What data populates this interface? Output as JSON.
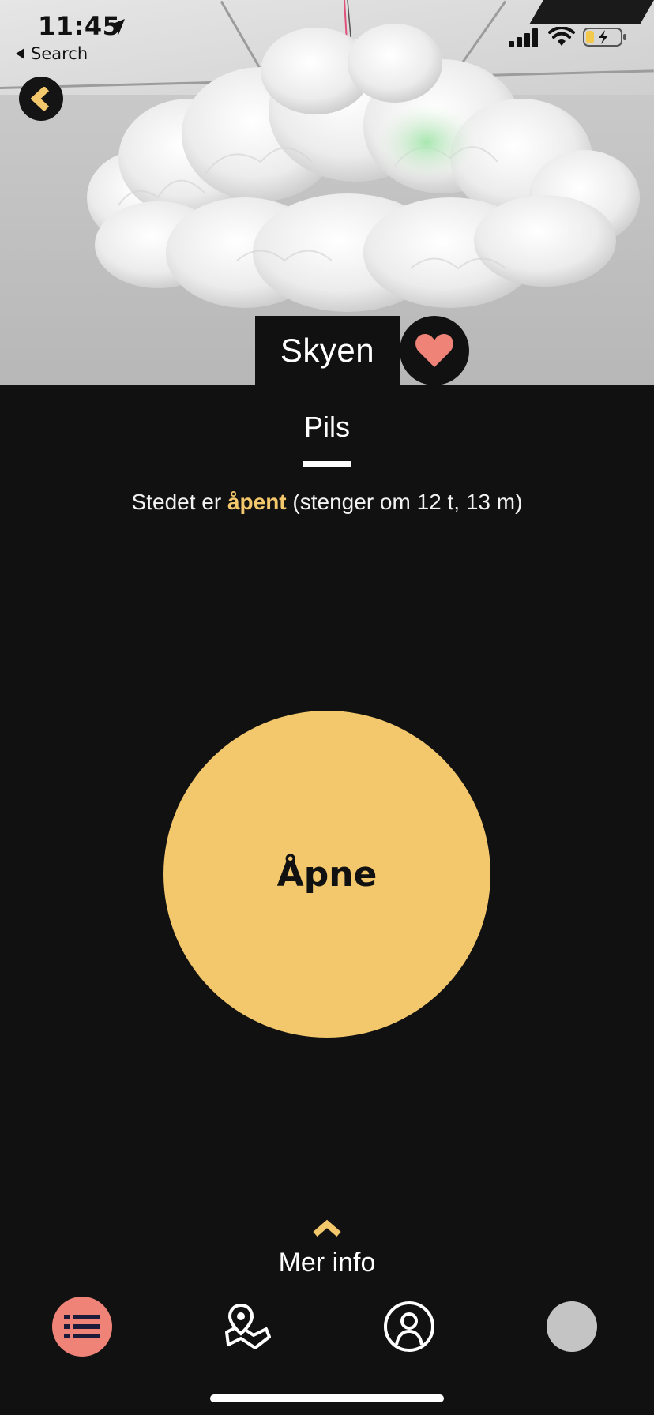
{
  "status_bar": {
    "time": "11:45",
    "back_app": "Search"
  },
  "header": {
    "title": "Skyen",
    "back_icon": "chevron-left-icon",
    "favorite_icon": "heart-icon",
    "favorite_active": true
  },
  "tabs": [
    {
      "label": "Pils",
      "active": true
    }
  ],
  "status": {
    "prefix": "Stedet er ",
    "state": "åpent",
    "suffix": " (stenger om 12 t, 13 m)"
  },
  "main_action": {
    "label": "Åpne"
  },
  "more_info": {
    "label": "Mer info",
    "icon": "chevron-up-icon"
  },
  "bottom_nav": [
    {
      "name": "list",
      "icon": "list-icon",
      "active": true
    },
    {
      "name": "map",
      "icon": "map-pin-icon",
      "active": false
    },
    {
      "name": "profile",
      "icon": "profile-icon",
      "active": false
    },
    {
      "name": "avatar",
      "icon": "avatar-icon",
      "active": false
    }
  ],
  "colors": {
    "background": "#111111",
    "accent": "#f3c76c",
    "favorite": "#f08377",
    "text": "#ffffff",
    "avatar": "#c4c4c4"
  }
}
